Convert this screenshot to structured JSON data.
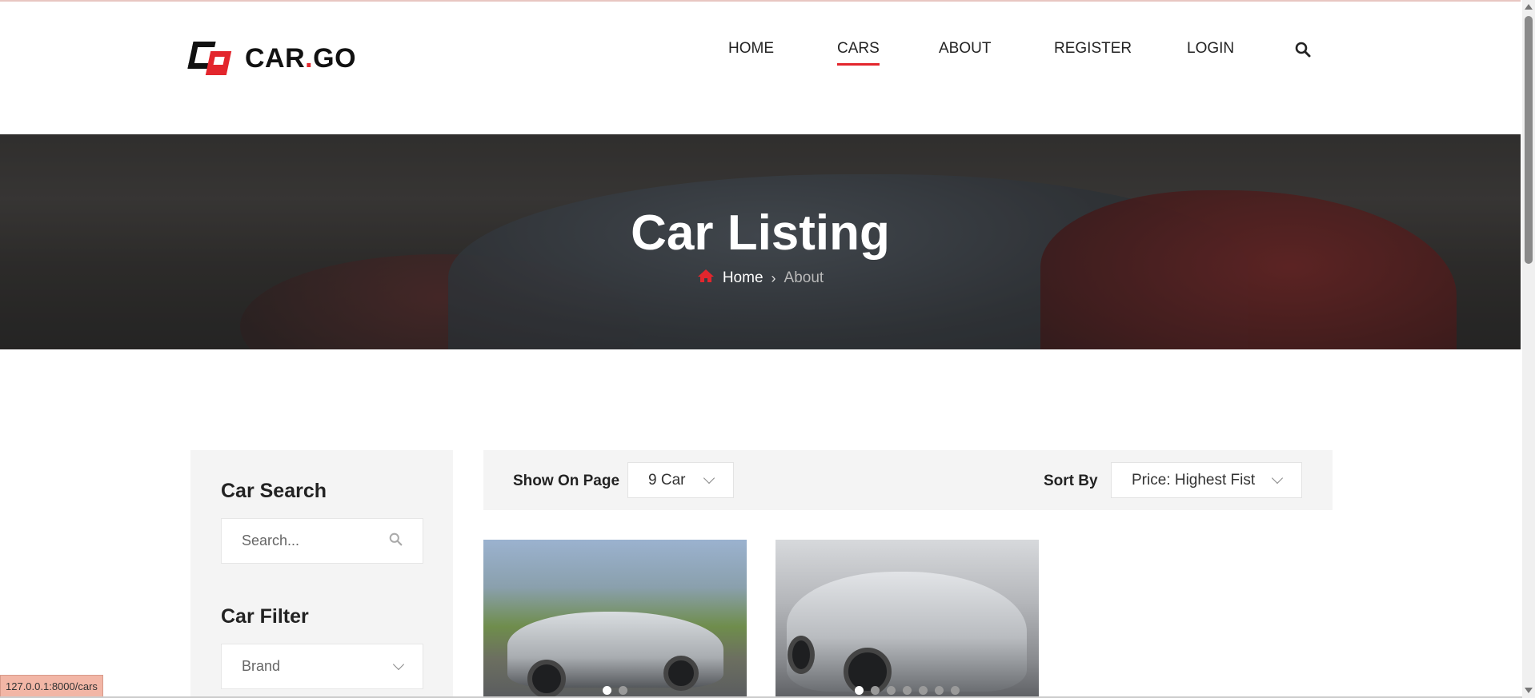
{
  "brand": {
    "name_part1": "CAR",
    "name_dot": ".",
    "name_part2": "GO"
  },
  "nav": {
    "items": [
      {
        "label": "HOME"
      },
      {
        "label": "CARS",
        "active": true
      },
      {
        "label": "ABOUT"
      },
      {
        "label": "REGISTER"
      },
      {
        "label": "LOGIN"
      }
    ],
    "search_icon": "search-icon"
  },
  "hero": {
    "title": "Car Listing",
    "breadcrumb": {
      "home": "Home",
      "current": "About"
    }
  },
  "sidebar": {
    "search_title": "Car Search",
    "search_placeholder": "Search...",
    "filter_title": "Car Filter",
    "brand_select": "Brand"
  },
  "toolbar": {
    "show_label": "Show On Page",
    "show_value": "9 Car",
    "sort_label": "Sort By",
    "sort_value": "Price: Highest Fist"
  },
  "cards": [
    {
      "slides": 2,
      "active": 0
    },
    {
      "slides": 7,
      "active": 0
    }
  ],
  "status_url": "127.0.0.1:8000/cars",
  "colors": {
    "accent": "#e3262d",
    "panel": "#f4f4f4"
  }
}
